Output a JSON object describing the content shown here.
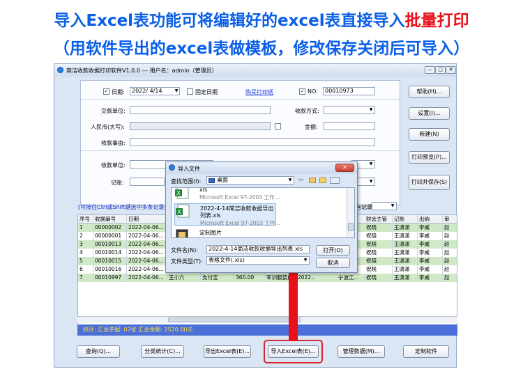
{
  "banner": {
    "line1_main": "导入Excel表功能可将编辑好的excel表直接导入",
    "line1_highlight": "批量打印",
    "line2": "（用软件导出的excel表做模板，修改保存关闭后可导入）"
  },
  "window": {
    "title": "简洁收款收据打印软件V1.0.0 --- 用户名：admin（管理员）"
  },
  "form": {
    "date_label": "日期:",
    "date_value": "2022/ 4/14",
    "fixed_date_label": "固定日期",
    "buy_paper_link": "购买打印纸",
    "no_label": "NO:",
    "no_value": "00010973",
    "payer_label": "交款单位:",
    "payment_method_label": "收款方式:",
    "rmb_label": "人民币(大写):",
    "amount_label": "金额:",
    "reason_label": "收款事由:",
    "receiver_label": "收款单位:",
    "bookkeeper_label": "记账:"
  },
  "side_buttons": [
    "帮助(H)...",
    "设置(I)...",
    "新建(N)",
    "打印预览(P)...",
    "打印并保存(S)"
  ],
  "hint": "[可按住Ctrl或Shift键选中多条记录批量",
  "filter_label": "有记录",
  "table": {
    "columns": [
      "序号",
      "收据编号",
      "日期",
      "",
      "",
      "",
      "",
      "",
      "财会主管",
      "记账",
      "出纳",
      "审"
    ],
    "rows": [
      {
        "cells": [
          "1",
          "00000002",
          "2022-04-06...",
          "",
          "",
          "",
          "",
          "祝晓",
          "王潇潇",
          "李威",
          "赵"
        ]
      },
      {
        "cells": [
          "2",
          "00000001",
          "2022-04-06...",
          "",
          "",
          "",
          "",
          "祝晓",
          "王潇潇",
          "李威",
          "赵"
        ]
      },
      {
        "cells": [
          "3",
          "00010013",
          "2022-04-06...",
          "",
          "",
          "",
          "",
          "祝晓",
          "王潇潇",
          "李威",
          "赵"
        ]
      },
      {
        "cells": [
          "4",
          "00010014",
          "2022-04-06...",
          "",
          "",
          "",
          "",
          "祝晓",
          "王潇潇",
          "李威",
          "赵"
        ]
      },
      {
        "cells": [
          "5",
          "00010015",
          "2022-04-06...",
          "",
          "",
          "",
          "",
          "祝晓",
          "王潇潇",
          "李威",
          "赵"
        ]
      },
      {
        "cells": [
          "6",
          "00010016",
          "2022-04-06...",
          "",
          "",
          "",
          "",
          "祝晓",
          "王潇潇",
          "李威",
          "赵"
        ]
      },
      {
        "cells": [
          "7",
          "00010997",
          "2022-04-06...",
          "王小六",
          "支付宝",
          "360.00",
          "军训服装费（2022...",
          "宁波江...",
          "祝晓",
          "王潇潇",
          "李威",
          "赵"
        ]
      }
    ]
  },
  "stats": "统计:   汇总单据: 07张      汇总金额: 2520.00元",
  "bottom_buttons": [
    "查询(Q)...",
    "分类统计(C)...",
    "导出Excel表(E)...",
    "导入Excel表(E)...",
    "管理数据(M)...",
    "定制软件"
  ],
  "dialog": {
    "title": "导入文件",
    "lookin_label": "查找范围(I):",
    "lookin_value": "桌面",
    "files": [
      {
        "name": "xls",
        "type": "Microsoft Excel 97-2003 工作..."
      },
      {
        "name": "2022-4-14简洁收款收据导出列表.xls",
        "type": "Microsoft Excel 97-2003 工作..."
      },
      {
        "name": "定制图片",
        "type": "快捷方式"
      }
    ],
    "filename_label": "文件名(N):",
    "filename_value": "2022-4-14简洁收款收据导出列表.xls",
    "filetype_label": "文件类型(T):",
    "filetype_value": "表格文件(.xls)",
    "open_button": "打开(O)",
    "cancel_button": "取消"
  }
}
